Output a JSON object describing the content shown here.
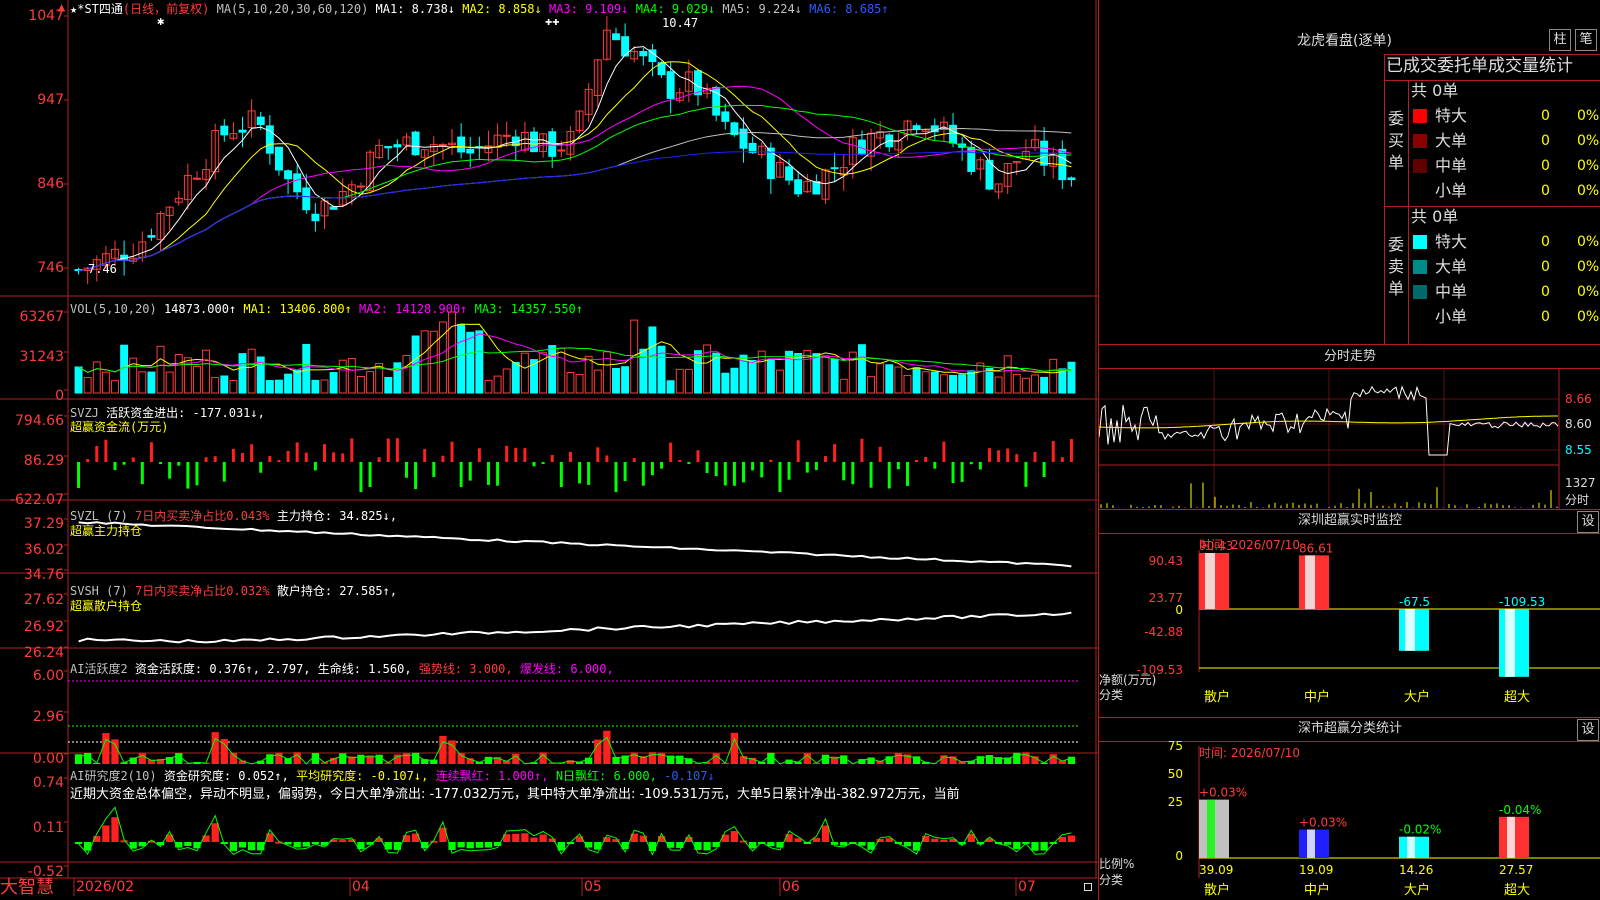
{
  "app": {
    "name": "大智慧",
    "indicator_marker": "▲"
  },
  "main": {
    "title": "★*ST四通",
    "period": "(日线，前复权)",
    "ma_head": "MA(5,10,20,30,60,120)",
    "ma1": "MA1: 8.738↓",
    "ma2": "MA2: 8.858↓",
    "ma3": "MA3: 9.109↓",
    "ma4": "MA4: 9.029↓",
    "ma5": "MA5: 9.224↓",
    "ma6": "MA6: 8.685↑",
    "axis": [
      "1047",
      "947",
      "846",
      "746"
    ],
    "high_label": "10.47",
    "low_label": "7.46",
    "stars": [
      "✱",
      "✚✚"
    ]
  },
  "vol": {
    "head": "VOL(5,10,20)",
    "value": "14873.000↑",
    "ma1": "MA1: 13406.800↑",
    "ma2": "MA2: 14128.900↑",
    "ma3": "MA3: 14357.550↑",
    "axis": [
      "63267",
      "31243",
      "0"
    ]
  },
  "svzj": {
    "head": "SVZJ",
    "label": "活跃资金进出: -177.031↓,",
    "sub": "超赢资金流(万元)",
    "axis": [
      "794.66",
      "86.29",
      "-622.07"
    ]
  },
  "svzl": {
    "head": "SVZL (7)",
    "ratio": "7日内买卖净占比0.043%",
    "hold": "主力持仓: 34.825↓,",
    "sub": "超赢主力持仓",
    "axis": [
      "37.29",
      "36.02",
      "34.76"
    ]
  },
  "svsh": {
    "head": "SVSH (7)",
    "ratio": "7日内买卖净占比0.032%",
    "hold": "散户持仓: 27.585↑,",
    "sub": "超赢散户持仓",
    "axis": [
      "27.62",
      "26.92",
      "26.24"
    ]
  },
  "ai1": {
    "head": "AI活跃度2",
    "act": "资金活跃度: 0.376↑,",
    "v2": "2.797,",
    "life": "生命线: 1.560,",
    "strong": "强势线: 3.000,",
    "burst": "爆发线: 6.000,",
    "axis": [
      "6.00",
      "2.96",
      "0.00"
    ]
  },
  "ai2": {
    "head": "AI研究度2(10)",
    "research": "资金研究度: 0.052↑,",
    "avg": "平均研究度: -0.107↓,",
    "cont": "连续飘红: 1.000↑,",
    "nday": "N日飘红: 6.000,",
    "last": "-0.107↓",
    "summary": "近期大资金总体偏空，异动不明显，偏弱势，今日大单净流出: -177.032万元，其中特大单净流出: -109.531万元，大单5日累计净出-382.972万元，当前",
    "axis": [
      "0.74",
      "0.11",
      "-0.52"
    ]
  },
  "dates": [
    "2026/02",
    "04",
    "05",
    "06",
    "07"
  ],
  "right": {
    "lhb": {
      "title": "龙虎看盘(逐单)",
      "btn1": "柱",
      "btn2": "笔",
      "header": "已成交委托单成交量统计",
      "buy_label": "委买单",
      "sell_label": "委卖单",
      "buy_total": "共 0单",
      "sell_total": "共 0单",
      "buy_rows": [
        {
          "name": "特大",
          "count": "0",
          "pct": "0%",
          "color": "#ff0000"
        },
        {
          "name": "大单",
          "count": "0",
          "pct": "0%",
          "color": "#8b0000"
        },
        {
          "name": "中单",
          "count": "0",
          "pct": "0%",
          "color": "#600000"
        },
        {
          "name": "小单",
          "count": "0",
          "pct": "0%",
          "color": ""
        }
      ],
      "sell_rows": [
        {
          "name": "特大",
          "count": "0",
          "pct": "0%",
          "color": "#00ffff"
        },
        {
          "name": "大单",
          "count": "0",
          "pct": "0%",
          "color": "#008b8b"
        },
        {
          "name": "中单",
          "count": "0",
          "pct": "0%",
          "color": "#006a6a"
        },
        {
          "name": "小单",
          "count": "0",
          "pct": "0%",
          "color": ""
        }
      ]
    },
    "intraday": {
      "title": "分时走势",
      "axis": [
        "8.66",
        "8.60",
        "8.55",
        "1327",
        "分时"
      ]
    },
    "monitor": {
      "title": "深圳超赢实时监控",
      "btn": "设",
      "time": "时间: 2026/07/10",
      "axis": [
        "90.43",
        "23.77",
        "0",
        "-42.88",
        "-109.53"
      ],
      "unit": "净额(万元)",
      "cat": "分类",
      "categories": [
        "散户",
        "中户",
        "大户",
        "超大"
      ],
      "values": [
        "90.43",
        "86.61",
        "-67.5",
        "-109.53"
      ],
      "nums": [
        90.43,
        86.61,
        -67.5,
        -109.53
      ]
    },
    "classify": {
      "title": "深市超赢分类统计",
      "btn": "设",
      "time": "时间: 2026/07/10",
      "axis": [
        "75",
        "50",
        "25",
        "0"
      ],
      "unit": "比例%",
      "cat": "分类",
      "categories": [
        "散户",
        "中户",
        "大户",
        "超大"
      ],
      "changes": [
        "+0.03%",
        "+0.03%",
        "-0.02%",
        "-0.04%"
      ],
      "values": [
        "39.09",
        "19.09",
        "14.26",
        "27.57"
      ],
      "nums": [
        39.09,
        19.09,
        14.26,
        27.57
      ]
    }
  },
  "colors": {
    "up": "#ff3b3b",
    "down": "#00ffff",
    "grid": "#b02020",
    "ma_white": "#ffffff",
    "ma_yellow": "#ffff00",
    "ma_magenta": "#ff00ff",
    "ma_green": "#00ff00",
    "ma_gray": "#c0c0c0",
    "ma_blue": "#2020ff"
  }
}
